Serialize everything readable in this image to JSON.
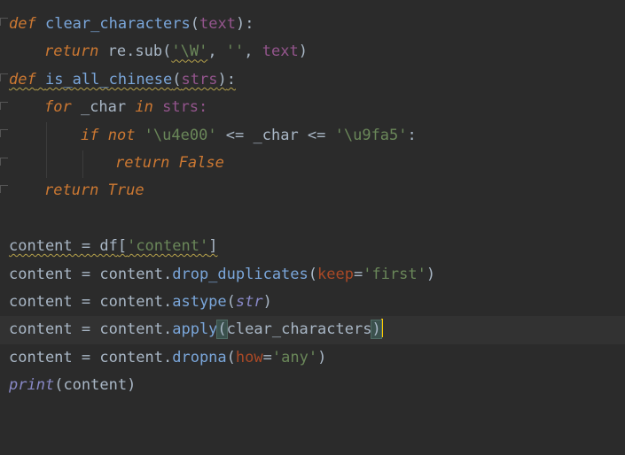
{
  "editor": {
    "lines": {
      "l1": {
        "kw": "def",
        "name": "clear_characters",
        "open": "(",
        "param": "text",
        "close": ")",
        "colon": ":"
      },
      "l2": {
        "kw": "return",
        "obj": "re.",
        "fn": "sub",
        "open": "(",
        "s1": "'\\W'",
        "comma1": ", ",
        "s2": "''",
        "comma2": ", ",
        "arg": "text",
        "close": ")"
      },
      "l3": {
        "kw": "def",
        "name": "is_all_chinese",
        "open": "(",
        "param": "strs",
        "close": ")",
        "colon": ":"
      },
      "l4": {
        "kw": "for",
        "var": " _char ",
        "kw2": "in",
        "rest": " strs:"
      },
      "l5": {
        "kw": "if",
        "kw2": " not ",
        "s1": "'\\u4e00'",
        "mid": " <= _char <= ",
        "s2": "'\\u9fa5'",
        "colon": ":"
      },
      "l6": {
        "kw": "return",
        "val": " False"
      },
      "l7": {
        "kw": "return",
        "val": " True"
      },
      "l9": {
        "lhs": "content = df",
        "open": "[",
        "s": "'content'",
        "close": "]"
      },
      "l10": {
        "lhs": "content = content.",
        "fn": "drop_duplicates",
        "open": "(",
        "kw": "keep",
        "eq": "=",
        "s": "'first'",
        "close": ")"
      },
      "l11": {
        "lhs": "content = content.",
        "fn": "astype",
        "open": "(",
        "arg": "str",
        "close": ")"
      },
      "l12": {
        "lhs": "content = content.",
        "fn": "apply",
        "open": "(",
        "arg": "clear_characters",
        "close": ")"
      },
      "l13": {
        "lhs": "content = content.",
        "fn": "dropna",
        "open": "(",
        "kw": "how",
        "eq": "=",
        "s": "'any'",
        "close": ")"
      },
      "l14": {
        "fn": "print",
        "open": "(",
        "arg": "content",
        "close": ")"
      }
    }
  }
}
